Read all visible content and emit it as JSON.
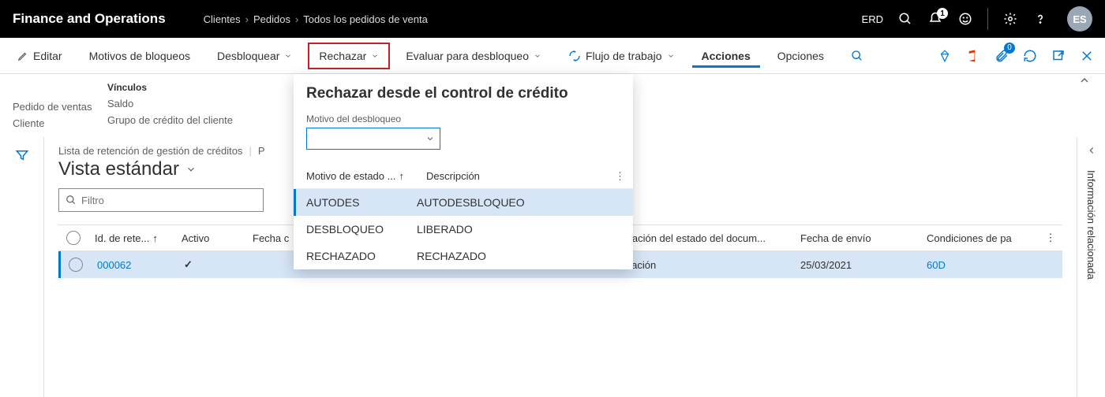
{
  "topbar": {
    "app_title": "Finance and Operations",
    "breadcrumb": [
      "Clientes",
      "Pedidos",
      "Todos los pedidos de venta"
    ],
    "company": "ERD",
    "bell_count": "1",
    "user_initials": "ES"
  },
  "actionbar": {
    "edit": "Editar",
    "motivos": "Motivos de bloqueos",
    "desbloquear": "Desbloquear",
    "rechazar": "Rechazar",
    "evaluar": "Evaluar para desbloqueo",
    "flujo": "Flujo de trabajo",
    "acciones": "Acciones",
    "opciones": "Opciones",
    "attach_count": "0"
  },
  "links": {
    "heading": "Vínculos",
    "col1": [
      "Pedido de ventas",
      "Cliente"
    ],
    "col2": [
      "Saldo",
      "Grupo de crédito del cliente"
    ]
  },
  "dropdown": {
    "title": "Rechazar desde el control de crédito",
    "field_label": "Motivo del desbloqueo",
    "col1": "Motivo de estado ...",
    "col2": "Descripción",
    "rows": [
      {
        "code": "AUTODES",
        "desc": "AUTODESBLOQUEO",
        "selected": true
      },
      {
        "code": "DESBLOQUEO",
        "desc": "LIBERADO",
        "selected": false
      },
      {
        "code": "RECHAZADO",
        "desc": "RECHAZADO",
        "selected": false
      }
    ]
  },
  "main": {
    "crumb": "Lista de retención de gestión de créditos",
    "crumb_extra": "P",
    "view_name": "Vista estándar",
    "filter_placeholder": "Filtro",
    "columns": {
      "id": "Id. de rete...",
      "activo": "Activo",
      "fecha": "Fecha c",
      "doc": "mprobación del estado del docum...",
      "envio": "Fecha de envío",
      "cond": "Condiciones de pa"
    },
    "row": {
      "id": "000062",
      "activo_check": "✓",
      "doc": "onfirmación",
      "envio": "25/03/2021",
      "cond": "60D"
    }
  },
  "rightrail": {
    "label": "Información relacionada"
  }
}
